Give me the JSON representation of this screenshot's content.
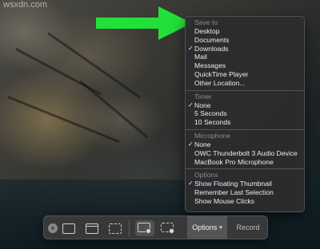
{
  "watermark": "wsxdn.com",
  "menu": {
    "sections": [
      {
        "header": "Save to",
        "items": [
          {
            "label": "Desktop",
            "checked": false
          },
          {
            "label": "Documents",
            "checked": false
          },
          {
            "label": "Downloads",
            "checked": true
          },
          {
            "label": "Mail",
            "checked": false
          },
          {
            "label": "Messages",
            "checked": false
          },
          {
            "label": "QuickTime Player",
            "checked": false
          },
          {
            "label": "Other Location...",
            "checked": false
          }
        ]
      },
      {
        "header": "Timer",
        "items": [
          {
            "label": "None",
            "checked": true
          },
          {
            "label": "5 Seconds",
            "checked": false
          },
          {
            "label": "10 Seconds",
            "checked": false
          }
        ]
      },
      {
        "header": "Microphone",
        "items": [
          {
            "label": "None",
            "checked": true
          },
          {
            "label": "OWC Thunderbolt 3 Audio Device",
            "checked": false
          },
          {
            "label": "MacBook Pro Microphone",
            "checked": false
          }
        ]
      },
      {
        "header": "Options",
        "items": [
          {
            "label": "Show Floating Thumbnail",
            "checked": true
          },
          {
            "label": "Remember Last Selection",
            "checked": false
          },
          {
            "label": "Show Mouse Clicks",
            "checked": false
          }
        ]
      }
    ],
    "checkmark": "✓"
  },
  "toolbar": {
    "close_glyph": "×",
    "options_label": "Options",
    "options_chevron": "▾",
    "record_label": "Record",
    "icons": [
      "capture-entire-screen-icon",
      "capture-window-icon",
      "capture-selection-icon",
      "record-entire-screen-icon",
      "record-selection-icon"
    ]
  },
  "colors": {
    "arrow": "#22e03a",
    "menu_bg": "#2c2c2e",
    "toolbar_bg": "#3a3a3c"
  }
}
